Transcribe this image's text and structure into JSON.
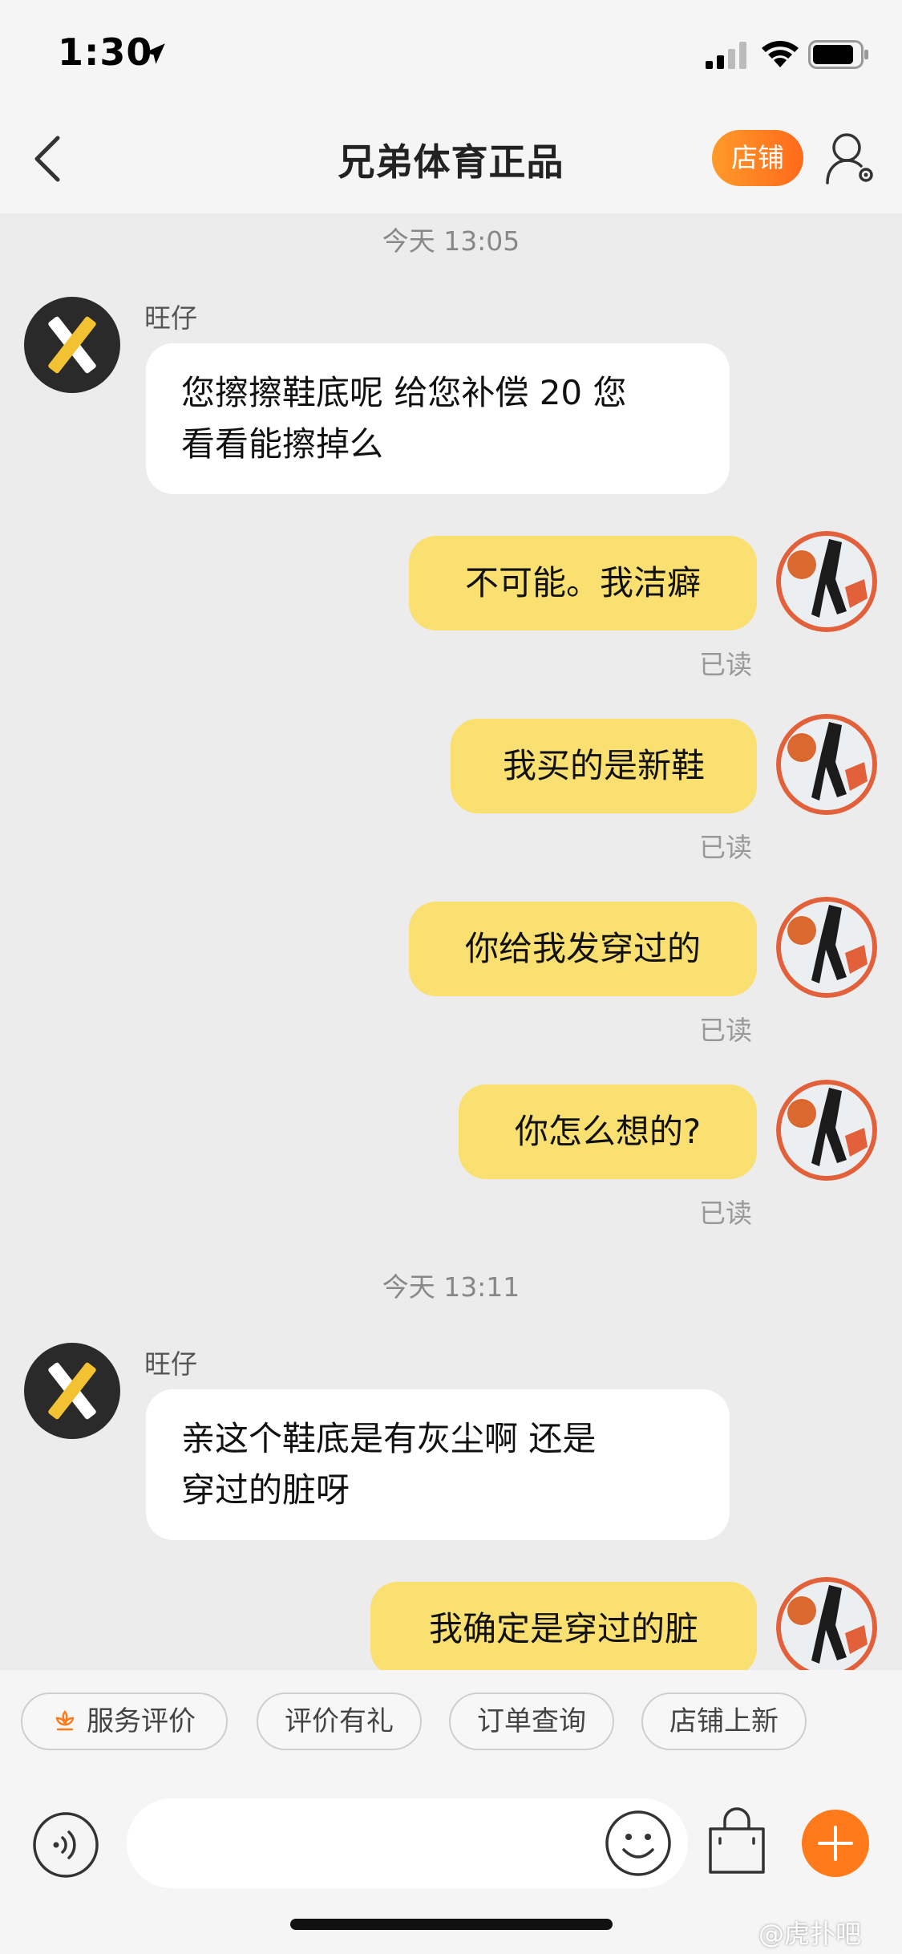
{
  "status_bar": {
    "time": "1:30"
  },
  "nav": {
    "title": "兄弟体育正品",
    "shop_button": "店铺"
  },
  "chat": {
    "timestamp_1": "今天 13:05",
    "timestamp_2": "今天 13:11",
    "shop_name": "旺仔",
    "incoming_1_line1": "您擦擦鞋底呢 给您补偿 20 您",
    "incoming_1_line2": "看看能擦掉么",
    "outgoing_1": "不可能。我洁癖",
    "outgoing_2": "我买的是新鞋",
    "outgoing_3": "你给我发穿过的",
    "outgoing_4": "你怎么想的?",
    "outgoing_5": "我确定是穿过的脏",
    "incoming_2_line1": "亲这个鞋底是有灰尘啊 还是",
    "incoming_2_line2": "穿过的脏呀",
    "read_label": "已读"
  },
  "quick_replies": [
    "服务评价",
    "评价有礼",
    "订单查询",
    "店铺上新"
  ],
  "input": {
    "placeholder": ""
  },
  "watermark": "@虎扑吧",
  "colors": {
    "accent": "#ff7a1a",
    "outgoing_bubble": "#f9e071",
    "incoming_bubble": "#ffffff",
    "background": "#ececec"
  }
}
